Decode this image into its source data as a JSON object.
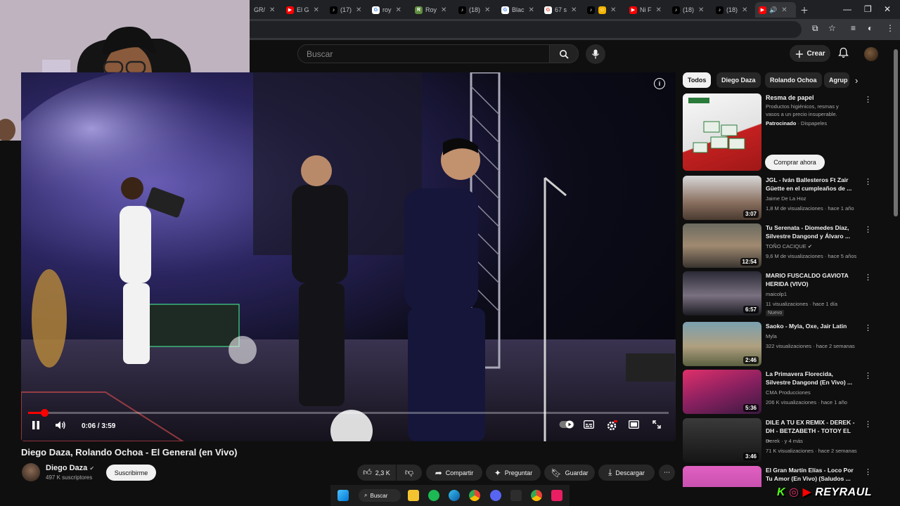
{
  "browser": {
    "tabs": [
      {
        "label": "GR/",
        "icon": "globe-icon",
        "color": "#5f6368"
      },
      {
        "label": "El G",
        "icon": "youtube-icon",
        "color": "#ff0000"
      },
      {
        "label": "(17)",
        "icon": "tiktok-icon",
        "color": "#000000"
      },
      {
        "label": "roy",
        "icon": "google-icon",
        "color": "#4285f4"
      },
      {
        "label": "Roy",
        "icon": "bookmark-icon",
        "color": "#5e8e3e"
      },
      {
        "label": "(18)",
        "icon": "tiktok-icon",
        "color": "#000000"
      },
      {
        "label": "Blac",
        "icon": "google-icon",
        "color": "#4285f4"
      },
      {
        "label": "67 s",
        "icon": "google-icon",
        "color": "#ea4335"
      },
      {
        "label": "",
        "icon": "tiktok-icon",
        "color": "#000000"
      },
      {
        "label": "",
        "icon": "emoji-icon",
        "color": "#f4b400"
      },
      {
        "label": "Ni F",
        "icon": "youtube-icon",
        "color": "#ff0000"
      },
      {
        "label": "(18)",
        "icon": "tiktok-icon",
        "color": "#000000"
      },
      {
        "label": "(18)",
        "icon": "tiktok-icon",
        "color": "#000000"
      },
      {
        "label": "",
        "icon": "youtube-icon",
        "color": "#ff0000"
      }
    ]
  },
  "header": {
    "search_placeholder": "Buscar",
    "create_label": "Crear"
  },
  "player": {
    "current_time": "0:06",
    "duration": "3:59",
    "time_text": "0:06 / 3:59",
    "progress_fraction": 0.025
  },
  "video": {
    "title": "Diego Daza, Rolando Ochoa - El General (en Vivo)",
    "channel": "Diego Daza",
    "subscribers": "497 K suscriptores",
    "subscribe_label": "Suscribirme",
    "likes": "2,3 K",
    "share_label": "Compartir",
    "ask_label": "Preguntar",
    "save_label": "Guardar",
    "download_label": "Descargar"
  },
  "chips": [
    "Todos",
    "Diego Daza",
    "Rolando Ochoa",
    "Agrup"
  ],
  "ad": {
    "title": "Resma de papel",
    "description": "Productos higiénicos, resmas y vasos a un precio insuperable.",
    "sponsored_label": "Patrocinado",
    "advertiser": "Dispapeles",
    "cta": "Comprar ahora"
  },
  "recommendations": [
    {
      "title": "JGL - Iván Ballesteros Ft Zair Güette en el cumpleaños de ...",
      "channel": "Jaime De La Hoz",
      "meta": "1,8 M de visualizaciones · hace 1 año",
      "duration": "3:07",
      "badge": ""
    },
    {
      "title": "Tu Serenata - Diomedes Díaz, Silvestre Dangond y Álvaro ...",
      "channel": "TOÑO CACIQUE",
      "meta": "9,6 M de visualizaciones · hace 5 años",
      "duration": "12:54",
      "badge": ""
    },
    {
      "title": "MARIO FUSCALDO GAVIOTA HERIDA (VIVO)",
      "channel": "maicolp1",
      "meta": "11 visualizaciones · hace 1 día",
      "duration": "6:57",
      "badge": "Nuevo"
    },
    {
      "title": "Saoko - Myla, Oxe, Jair Latin",
      "channel": "Myla",
      "meta": "322 visualizaciones · hace 2 semanas",
      "duration": "2:46",
      "badge": ""
    },
    {
      "title": "La Primavera Florecida, Silvestre Dangond (En Vivo) ...",
      "channel": "CMA Producciones",
      "meta": "206 K visualizaciones · hace 1 año",
      "duration": "5:36",
      "badge": ""
    },
    {
      "title": "DILE A TU EX REMIX - DEREK - DH - BETZABETH - TOTOY EL ...",
      "channel": "Derek · y 4 más",
      "meta": "71 K visualizaciones · hace 2 semanas",
      "duration": "3:46",
      "badge": ""
    },
    {
      "title": "El Gran Martín Elías - Loco Por Tu Amor (En Vivo) (Saludos ...",
      "channel": "",
      "meta": "",
      "duration": "",
      "badge": ""
    }
  ],
  "taskbar": {
    "search_label": "Buscar"
  },
  "watermark": "REYRAUL"
}
